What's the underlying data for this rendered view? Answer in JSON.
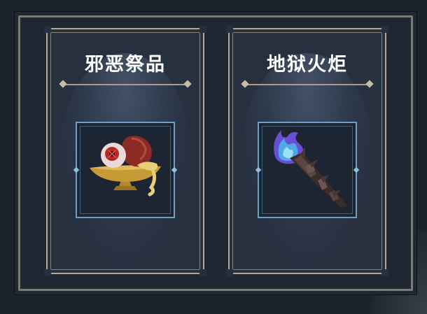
{
  "cards": [
    {
      "title": "邪恶祭品",
      "icon": "offering-bowl-eyeball-icon"
    },
    {
      "title": "地狱火炬",
      "icon": "hellfire-torch-icon"
    }
  ]
}
